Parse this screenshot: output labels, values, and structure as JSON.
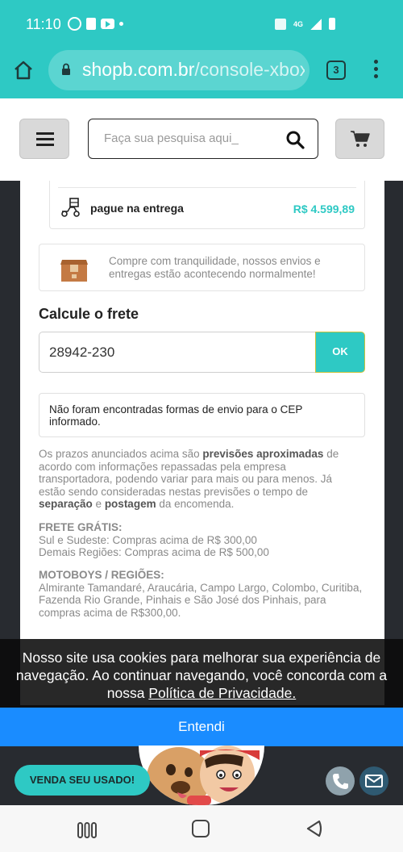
{
  "statusbar": {
    "time": "11:10",
    "network": "4G"
  },
  "browser": {
    "url_domain": "shopb.com.br",
    "url_path": "/console-xbox-",
    "tab_count": "3"
  },
  "header": {
    "search_placeholder": "Faça sua pesquisa aqui_"
  },
  "payment": {
    "label": "pague na entrega",
    "price": "R$ 4.599,89"
  },
  "shipping_notice": "Compre com tranquilidade, nossos envios e entregas estão acontecendo normalmente!",
  "freight": {
    "title": "Calcule o frete",
    "cep_value": "28942-230",
    "ok_label": "OK",
    "message": "Não foram encontradas formas de envio para o CEP informado."
  },
  "prazos": {
    "t1": "Os prazos anunciados acima são ",
    "b1": "previsões aproximadas",
    "t2": " de acordo com informações repassadas pela empresa transportadora, podendo variar para mais ou para menos. Já estão sendo consideradas nestas previsões o tempo de ",
    "b2": "separação",
    "t3": " e ",
    "b3": "postagem",
    "t4": " da encomenda."
  },
  "frete_gratis": {
    "heading": "FRETE GRÁTIS:",
    "line1": "Sul e Sudeste: Compras acima de R$ 300,00",
    "line2": "Demais Regiões: Compras acima de R$ 500,00"
  },
  "motoboys": {
    "heading": "MOTOBOYS / REGIÕES:",
    "text": "Almirante Tamandaré, Araucária, Campo Largo, Colombo, Curitiba, Fazenda Rio Grande, Pinhais e São José dos Pinhais, para compras acima de R$300,00."
  },
  "cookie": {
    "text": "Nosso site usa cookies para melhorar sua experiência de navegação. Ao continuar navegando, você concorda com a nossa ",
    "link": "Política de Privacidade.",
    "accept_label": "Entendi"
  },
  "venda_label": "VENDA SEU USADO!",
  "colors": {
    "accent": "#2ec9c4",
    "cookie_button": "#1a8cff",
    "frame": "#282b30"
  }
}
